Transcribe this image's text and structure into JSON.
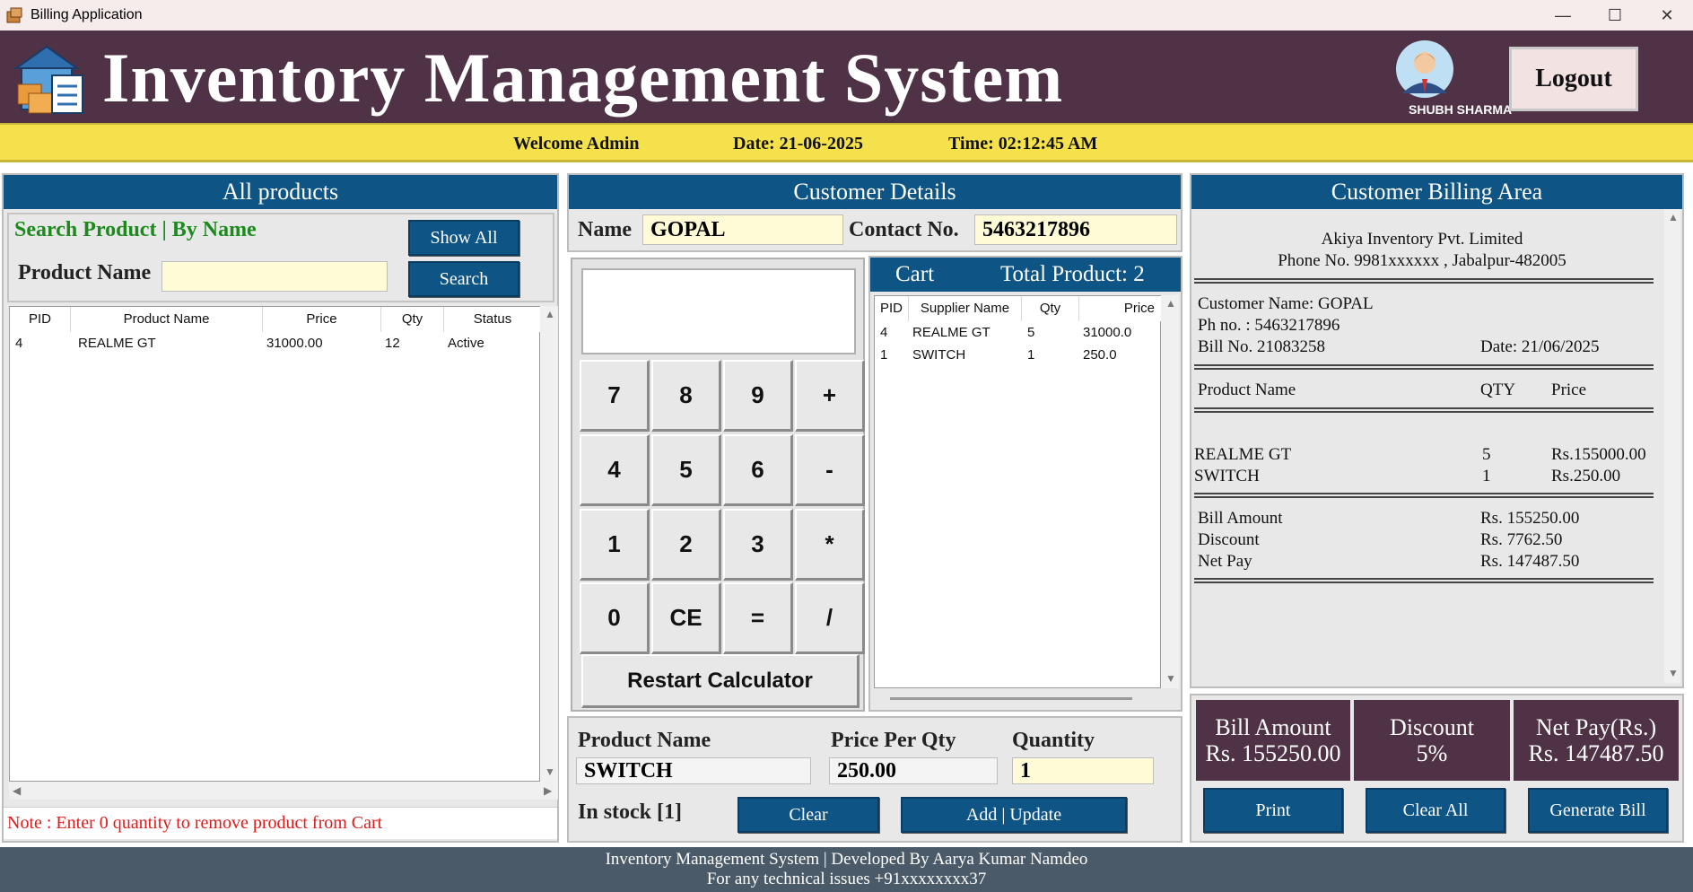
{
  "window": {
    "title": "Billing Application"
  },
  "header": {
    "app_title": "Inventory Management System",
    "user_name": "SHUBH SHARMA",
    "logout_label": "Logout"
  },
  "welcome": {
    "greeting": "Welcome Admin",
    "date": "Date: 21-06-2025",
    "time": "Time: 02:12:45 AM"
  },
  "products": {
    "heading": "All products",
    "search_title": "Search Product | By Name",
    "product_name_label": "Product Name",
    "product_name_value": "",
    "show_all_label": "Show All",
    "search_label": "Search",
    "columns": [
      "PID",
      "Product Name",
      "Price",
      "Qty",
      "Status"
    ],
    "rows": [
      [
        "4",
        "REALME GT",
        "31000.00",
        "12",
        "Active"
      ]
    ],
    "note": "Note : Enter 0 quantity to remove product from Cart"
  },
  "customer": {
    "heading": "Customer Details",
    "name_label": "Name",
    "name_value": "GOPAL",
    "contact_label": "Contact No.",
    "contact_value": "5463217896"
  },
  "calculator": {
    "display": "",
    "keys": [
      "7",
      "8",
      "9",
      "+",
      "4",
      "5",
      "6",
      "-",
      "1",
      "2",
      "3",
      "*",
      "0",
      "CE",
      "=",
      "/"
    ],
    "restart_label": "Restart Calculator"
  },
  "cart": {
    "title": "Cart",
    "total_label": "Total Product: 2",
    "columns": [
      "PID",
      "Supplier Name",
      "Qty",
      "Price"
    ],
    "rows": [
      [
        "4",
        "REALME GT",
        "5",
        "31000.0"
      ],
      [
        "1",
        "SWITCH",
        "1",
        "250.0"
      ]
    ]
  },
  "cart_entry": {
    "product_name_label": "Product Name",
    "product_name_value": "SWITCH",
    "price_label": "Price Per Qty",
    "price_value": "250.00",
    "qty_label": "Quantity",
    "qty_value": "1",
    "stock_label": "In stock [1]",
    "clear_label": "Clear",
    "add_update_label": "Add | Update"
  },
  "billing": {
    "heading": "Customer Billing Area",
    "company": "Akiya Inventory Pvt. Limited",
    "company_contact": "Phone No. 9981xxxxxx , Jabalpur-482005",
    "customer_name": "Customer Name: GOPAL",
    "phone": "Ph no. : 5463217896",
    "bill_no": "Bill No. 21083258",
    "bill_date": "Date: 21/06/2025",
    "col_product": "Product Name",
    "col_qty": "QTY",
    "col_price": "Price",
    "items": [
      {
        "name": "REALME GT",
        "qty": "5",
        "price": "Rs.155000.00"
      },
      {
        "name": "SWITCH",
        "qty": "1",
        "price": "Rs.250.00"
      }
    ],
    "bill_amount_label": "Bill Amount",
    "bill_amount_value": "Rs. 155250.00",
    "discount_label": "Discount",
    "discount_value": "Rs. 7762.50",
    "net_pay_label": "Net Pay",
    "net_pay_value": "Rs. 147487.50"
  },
  "summary": {
    "bill_amount_title": "Bill Amount",
    "bill_amount_value": "Rs. 155250.00",
    "discount_title": "Discount",
    "discount_value": "5%",
    "net_pay_title": "Net Pay(Rs.)",
    "net_pay_value": "Rs. 147487.50",
    "print_label": "Print",
    "clear_all_label": "Clear All",
    "generate_label": "Generate Bill"
  },
  "footer": {
    "line1": "Inventory Management System | Developed By Aarya Kumar Namdeo",
    "line2": "For any technical issues +91xxxxxxxx37"
  },
  "colors": {
    "header_bg": "#503246",
    "welcome_bg": "#f5e14c",
    "panel_head": "#0e5485",
    "footer_bg": "#4a5a69",
    "search_title": "#1d8a1d",
    "note": "#e01b1b"
  }
}
